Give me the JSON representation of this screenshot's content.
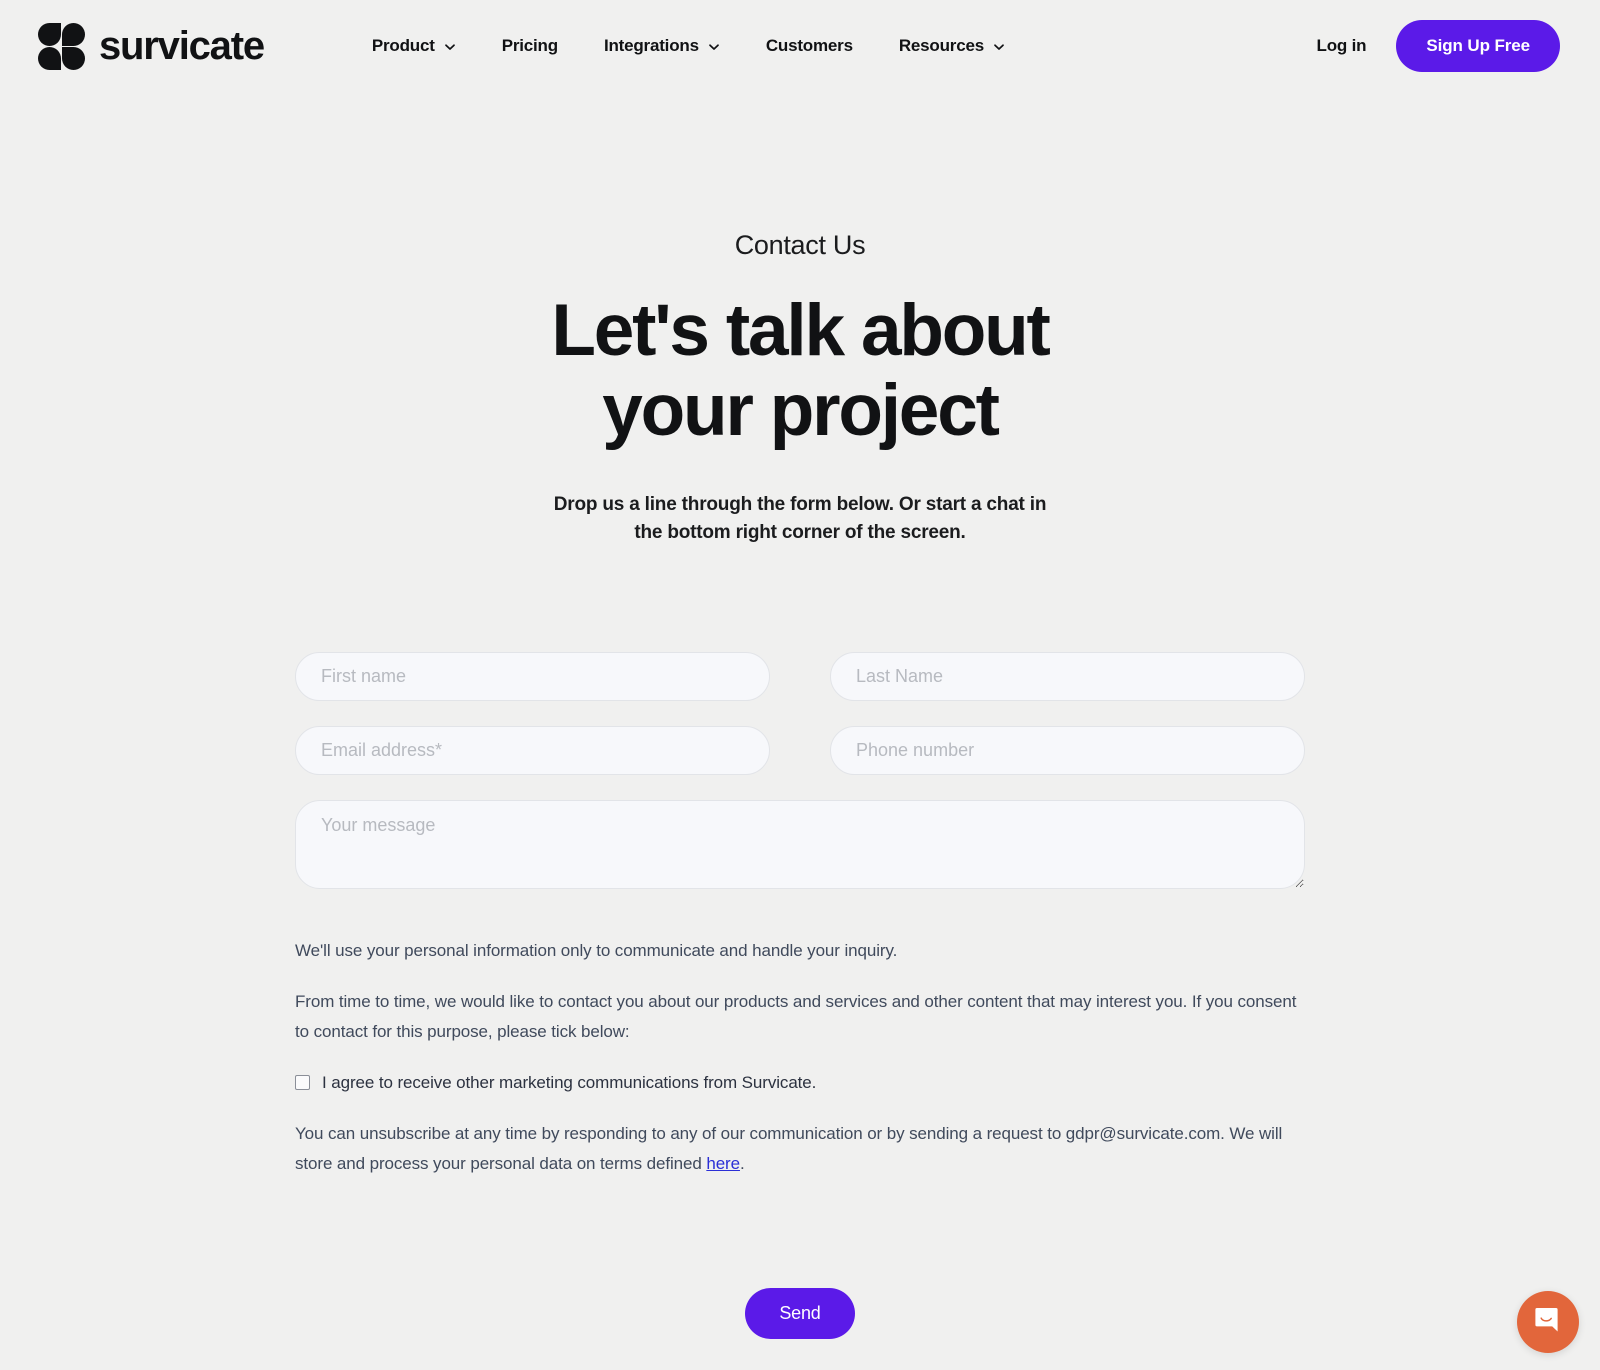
{
  "brand": {
    "name": "survicate",
    "logo_icon": "survicate-petals-logo",
    "accent_color": "#5b1ae8",
    "page_background": "#f0f0ef"
  },
  "header": {
    "nav": [
      {
        "label": "Product",
        "has_dropdown": true,
        "icon": "chevron-down-icon"
      },
      {
        "label": "Pricing",
        "has_dropdown": false
      },
      {
        "label": "Integrations",
        "has_dropdown": true,
        "icon": "chevron-down-icon"
      },
      {
        "label": "Customers",
        "has_dropdown": false
      },
      {
        "label": "Resources",
        "has_dropdown": true,
        "icon": "chevron-down-icon"
      }
    ],
    "login_label": "Log in",
    "signup_label": "Sign Up Free"
  },
  "hero": {
    "eyebrow": "Contact Us",
    "title_line1": "Let's talk about",
    "title_line2": "your project",
    "subtitle_line1": "Drop us a line through the form below. Or start a chat in",
    "subtitle_line2": "the bottom right corner of the screen."
  },
  "form": {
    "first_name_placeholder": "First name",
    "first_name_value": "",
    "last_name_placeholder": "Last Name",
    "last_name_value": "",
    "email_placeholder": "Email address*",
    "email_value": "",
    "phone_placeholder": "Phone number",
    "phone_value": "",
    "message_placeholder": "Your message",
    "message_value": "",
    "submit_label": "Send"
  },
  "legal": {
    "paragraph1": "We'll use your personal information only to communicate and handle your inquiry.",
    "paragraph2": "From time to time, we would like to contact you about our products and services and other content that may interest you. If you consent to contact for this purpose, please tick below:",
    "consent_label": "I agree to receive other marketing communications from Survicate.",
    "consent_checked": false,
    "unsubscribe_text_before": "You can unsubscribe at any time by responding to any of our communication or by sending a request to gdpr@survicate.com. We will store and process your personal data on terms defined ",
    "unsubscribe_link": "here",
    "unsubscribe_text_after": ".",
    "link_color": "#2b2fd6"
  },
  "chat": {
    "icon": "chat-bubble-icon",
    "background_color": "#e2663b"
  }
}
